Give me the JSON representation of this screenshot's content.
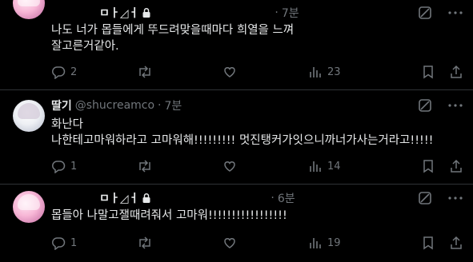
{
  "tweets": [
    {
      "name": "ㅁㅏ◿ㅓ",
      "handle": "",
      "time": "7분",
      "lines": [
        "나도 너가 몹들에게 뚜드려맞을때마다 희열을 느껴",
        "잘고른거같아."
      ],
      "replies": "2",
      "retweets": "",
      "likes": "",
      "views": "23",
      "locked": true
    },
    {
      "name": "딸기",
      "handle": "@shucreamco",
      "time": "7분",
      "lines": [
        "화난다",
        "나한테고마워하라고 고마워해!!!!!!!!! 멋진탱커가잇으니까너가사는거라고!!!!!"
      ],
      "replies": "1",
      "retweets": "",
      "likes": "",
      "views": "14",
      "locked": false
    },
    {
      "name": "ㅁㅏ◿ㅓ",
      "handle": "",
      "time": "6분",
      "lines": [
        "몹들아 나말고잴때려줘서 고마워!!!!!!!!!!!!!!!!!"
      ],
      "replies": "1",
      "retweets": "",
      "likes": "",
      "views": "19",
      "locked": true
    }
  ],
  "dot": "·",
  "colors": {
    "background": "#000000",
    "text": "#e7e9ea",
    "muted": "#71767b",
    "divider": "#2f3336"
  },
  "icons": [
    "reply-icon",
    "retweet-icon",
    "like-icon",
    "views-icon",
    "bookmark-icon",
    "share-icon",
    "grok-icon",
    "more-icon",
    "lock-icon"
  ]
}
